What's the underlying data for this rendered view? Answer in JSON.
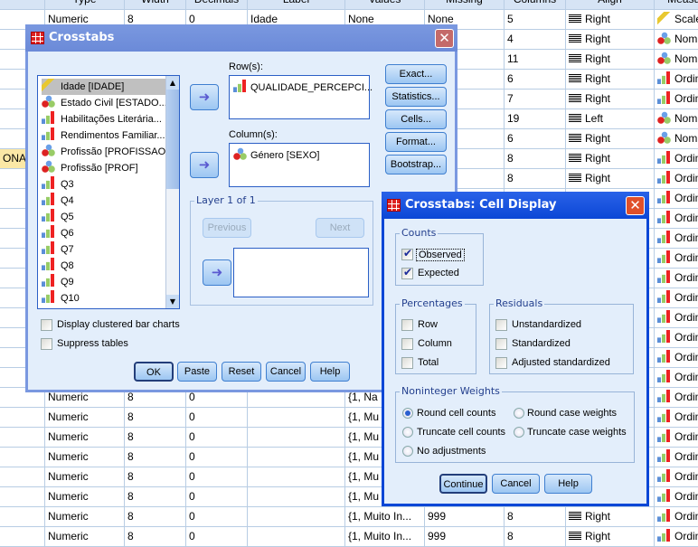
{
  "grid": {
    "headers": [
      "",
      "Type",
      "Width",
      "Decimals",
      "Label",
      "Values",
      "Missing",
      "Columns",
      "Align",
      "Measure"
    ],
    "rows": [
      {
        "name": "",
        "type": "Numeric",
        "width": "8",
        "decimals": "0",
        "label": "Idade",
        "values": "None",
        "missing": "None",
        "columns": "5",
        "align": "Right",
        "measure": "Scale"
      },
      {
        "name": "",
        "type": "",
        "width": "",
        "decimals": "",
        "label": "",
        "values": "",
        "missing": "",
        "columns": "4",
        "align": "Right",
        "measure": "Nominal"
      },
      {
        "name": "",
        "type": "",
        "width": "",
        "decimals": "",
        "label": "",
        "values": "",
        "missing": "",
        "columns": "11",
        "align": "Right",
        "measure": "Nominal"
      },
      {
        "name": "",
        "type": "",
        "width": "",
        "decimals": "",
        "label": "",
        "values": "",
        "missing": "",
        "columns": "6",
        "align": "Right",
        "measure": "Ordinal"
      },
      {
        "name": "",
        "type": "",
        "width": "",
        "decimals": "",
        "label": "",
        "values": "",
        "missing": "",
        "columns": "7",
        "align": "Right",
        "measure": "Ordinal"
      },
      {
        "name": "",
        "type": "",
        "width": "",
        "decimals": "",
        "label": "",
        "values": "",
        "missing": "",
        "columns": "19",
        "align": "Left",
        "measure": "Nominal"
      },
      {
        "name": "",
        "type": "",
        "width": "",
        "decimals": "",
        "label": "",
        "values": "",
        "missing": "",
        "columns": "6",
        "align": "Right",
        "measure": "Nominal"
      },
      {
        "name": "ONA",
        "type": "",
        "width": "",
        "decimals": "",
        "label": "",
        "values": "",
        "missing": "",
        "columns": "8",
        "align": "Right",
        "measure": "Ordinal",
        "selected": true
      },
      {
        "name": "",
        "type": "",
        "width": "",
        "decimals": "",
        "label": "",
        "values": "",
        "missing": "",
        "columns": "8",
        "align": "Right",
        "measure": "Ordinal"
      },
      {
        "measure": "Ordinal"
      },
      {
        "measure": "Ordinal"
      },
      {
        "measure": "Ordinal"
      },
      {
        "measure": "Ordinal"
      },
      {
        "measure": "Ordinal"
      },
      {
        "measure": "Ordinal"
      },
      {
        "measure": "Ordinal"
      },
      {
        "measure": "Ordinal"
      },
      {
        "measure": "Ordinal"
      },
      {
        "measure": "Ordinal"
      },
      {
        "type": "Numeric",
        "width": "8",
        "decimals": "0",
        "label": "",
        "values": "{1, Na",
        "measure": "Ordinal"
      },
      {
        "type": "Numeric",
        "width": "8",
        "decimals": "0",
        "label": "",
        "values": "{1, Mu",
        "measure": "Ordinal"
      },
      {
        "type": "Numeric",
        "width": "8",
        "decimals": "0",
        "label": "",
        "values": "{1, Mu",
        "measure": "Ordinal"
      },
      {
        "type": "Numeric",
        "width": "8",
        "decimals": "0",
        "label": "",
        "values": "{1, Mu",
        "measure": "Ordinal"
      },
      {
        "type": "Numeric",
        "width": "8",
        "decimals": "0",
        "label": "",
        "values": "{1, Mu",
        "measure": "Ordinal"
      },
      {
        "type": "Numeric",
        "width": "8",
        "decimals": "0",
        "label": "",
        "values": "{1, Mu",
        "measure": "Ordinal"
      },
      {
        "type": "Numeric",
        "width": "8",
        "decimals": "0",
        "label": "",
        "values": "{1, Muito In...",
        "missing": "999",
        "columns": "8",
        "align": "Right",
        "measure": "Ordinal"
      },
      {
        "type": "Numeric",
        "width": "8",
        "decimals": "0",
        "label": "",
        "values": "{1, Muito In...",
        "missing": "999",
        "columns": "8",
        "align": "Right",
        "measure": "Ordinal"
      }
    ]
  },
  "crosstabs": {
    "title": "Crosstabs",
    "close": "✕",
    "variables": [
      {
        "label": "Idade [IDADE]",
        "icon": "scale",
        "selected": true
      },
      {
        "label": "Estado Civil [ESTADO...",
        "icon": "nominal"
      },
      {
        "label": "Habilitações Literária...",
        "icon": "ordinal"
      },
      {
        "label": "Rendimentos Familiar...",
        "icon": "ordinal"
      },
      {
        "label": "Profissão [PROFISSAO]",
        "icon": "nominal-string"
      },
      {
        "label": "Profissão [PROF]",
        "icon": "nominal"
      },
      {
        "label": "Q3",
        "icon": "ordinal"
      },
      {
        "label": "Q4",
        "icon": "ordinal"
      },
      {
        "label": "Q5",
        "icon": "ordinal"
      },
      {
        "label": "Q6",
        "icon": "ordinal"
      },
      {
        "label": "Q7",
        "icon": "ordinal"
      },
      {
        "label": "Q8",
        "icon": "ordinal"
      },
      {
        "label": "Q9",
        "icon": "ordinal"
      },
      {
        "label": "Q10",
        "icon": "ordinal"
      }
    ],
    "rows_label": "Row(s):",
    "rows_value": "QUALIDADE_PERCEPCI...",
    "columns_label": "Column(s):",
    "columns_value": "Género [SEXO]",
    "layer_label": "Layer 1 of 1",
    "previous": "Previous",
    "next": "Next",
    "side_buttons": [
      "Exact...",
      "Statistics...",
      "Cells...",
      "Format...",
      "Bootstrap..."
    ],
    "clustered_bar": "Display clustered bar charts",
    "suppress_tables": "Suppress tables",
    "buttons": {
      "ok": "OK",
      "paste": "Paste",
      "reset": "Reset",
      "cancel": "Cancel",
      "help": "Help"
    }
  },
  "cell_display": {
    "title": "Crosstabs: Cell Display",
    "close": "✕",
    "counts_label": "Counts",
    "observed": "Observed",
    "expected": "Expected",
    "percentages_label": "Percentages",
    "row": "Row",
    "column": "Column",
    "total": "Total",
    "residuals_label": "Residuals",
    "unstandardized": "Unstandardized",
    "standardized": "Standardized",
    "adjusted": "Adjusted standardized",
    "weights_label": "Noninteger Weights",
    "round_cell": "Round cell counts",
    "round_case": "Round case weights",
    "truncate_cell": "Truncate cell counts",
    "truncate_case": "Truncate case weights",
    "no_adjust": "No adjustments",
    "selected_weight": "Round cell counts",
    "continue": "Continue",
    "cancel": "Cancel",
    "help": "Help"
  }
}
